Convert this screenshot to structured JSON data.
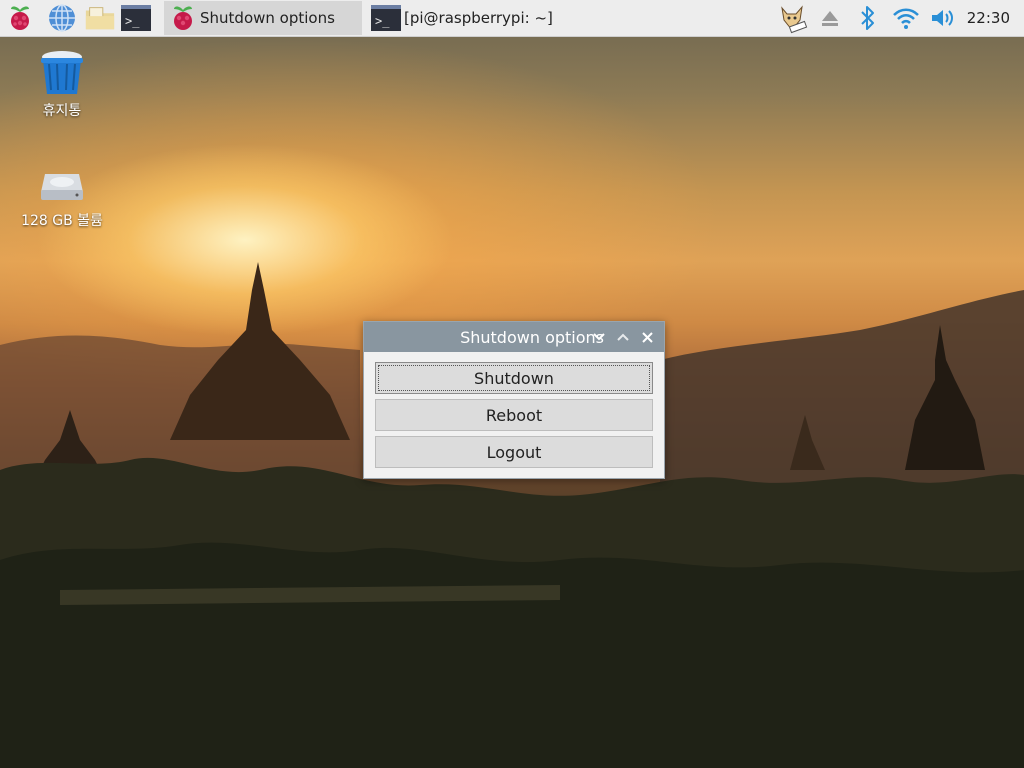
{
  "taskbar": {
    "launchers": [
      {
        "icon": "raspberry-menu-icon"
      },
      {
        "icon": "web-browser-icon"
      },
      {
        "icon": "file-manager-icon"
      },
      {
        "icon": "terminal-icon"
      }
    ],
    "tasks": [
      {
        "label": "Shutdown options",
        "icon": "raspberry-icon",
        "active": true
      },
      {
        "label": "[pi@raspberrypi: ~]",
        "icon": "terminal-icon",
        "active": false
      }
    ],
    "tray": [
      "vnc-cat-icon",
      "eject-icon",
      "bluetooth-icon",
      "wifi-icon",
      "volume-icon"
    ],
    "clock": "22:30"
  },
  "desktop": {
    "icons": [
      {
        "label": "휴지통",
        "icon": "trash-icon"
      },
      {
        "label": "128 GB 볼륨",
        "icon": "drive-icon"
      }
    ]
  },
  "dialog": {
    "title": "Shutdown options",
    "buttons": [
      "Shutdown",
      "Reboot",
      "Logout"
    ],
    "window_controls": [
      "minimize-icon",
      "maximize-icon",
      "close-icon"
    ]
  },
  "colors": {
    "taskbar_bg": "#ededed",
    "dialog_titlebar": "#8996a0",
    "tray_blue": "#2a8fd6"
  }
}
